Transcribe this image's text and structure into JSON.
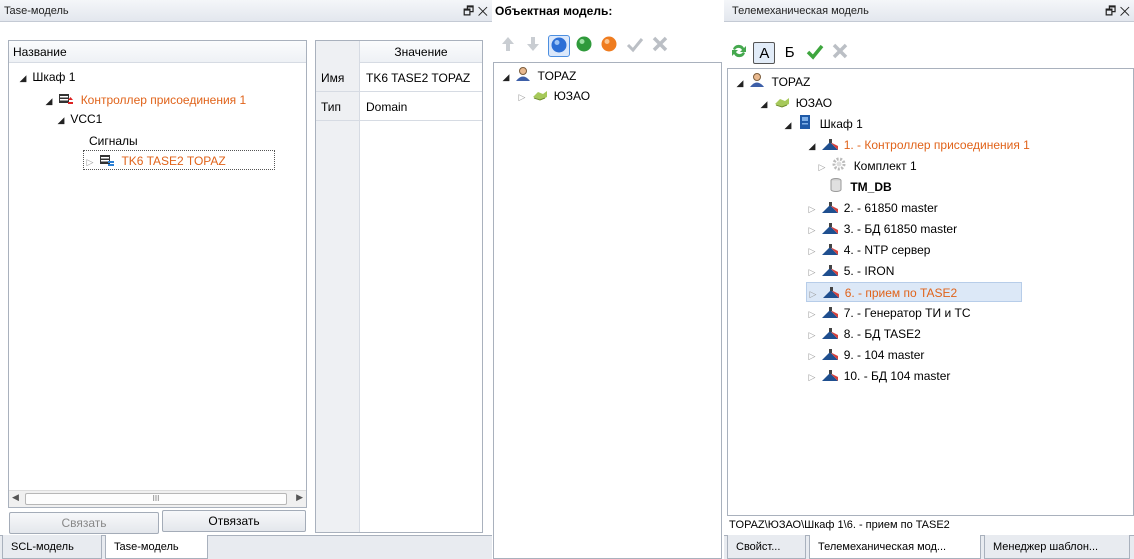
{
  "left_panel": {
    "title": "Tase-модель",
    "window_btns": "🗗 ✕",
    "tree_header": "Название",
    "tree": {
      "n1": "Шкаф 1",
      "n2": "Контроллер присоединения 1",
      "n3": "VCC1",
      "n4": "Сигналы",
      "n5": "TK6 TASE2 TOPAZ"
    },
    "scroll_grip": "III",
    "link_button": "Связать",
    "unlink_button": "Отвязать"
  },
  "props": {
    "value_header": "Значение",
    "rows": [
      {
        "name": "Имя",
        "value": "TK6 TASE2 TOPAZ"
      },
      {
        "name": "Тип",
        "value": "Domain"
      }
    ]
  },
  "middle_panel": {
    "title": "Объектная модель:",
    "tree": {
      "n1": "TOPAZ",
      "n2": "ЮЗАО"
    }
  },
  "right_panel": {
    "title": "Телемеханическая модель",
    "window_btns": "🗗 ✕",
    "toolbar": {
      "a_label": "А",
      "b_label": "Б"
    },
    "tree": {
      "n1": "TOPAZ",
      "n2": "ЮЗАО",
      "n3": "Шкаф 1",
      "n4": "1. - Контроллер присоединения 1",
      "n5": "Комплект 1",
      "n6": "TM_DB",
      "n7": "2. - 61850 master",
      "n8": "3. - БД 61850 master",
      "n9": "4. - NTP сервер",
      "n10": "5. - IRON",
      "n11": "6. - прием по TASE2",
      "n12": "7. - Генератор ТИ и ТС",
      "n13": "8. - БД TASE2",
      "n14": "9. - 104 master",
      "n15": "10. - БД 104 master"
    },
    "status_path": "TOPAZ\\ЮЗАО\\Шкаф 1\\6. - прием по TASE2"
  },
  "bottom_tabs_left": [
    "SCL-модель",
    "Tase-модель"
  ],
  "bottom_tabs_right": [
    "Свойст...",
    "Телемеханическая мод...",
    "Менеджер шаблон..."
  ],
  "colors": {
    "accent_orange": "#e0631a",
    "selection": "#dce8f7"
  }
}
